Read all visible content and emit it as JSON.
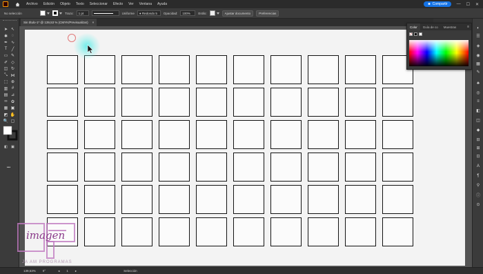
{
  "menubar": {
    "items": [
      "Archivo",
      "Edición",
      "Objeto",
      "Texto",
      "Seleccionar",
      "Efecto",
      "Ver",
      "Ventana",
      "Ayuda"
    ],
    "share_label": "Compartir"
  },
  "controlbar": {
    "selection_label": "No selección",
    "stroke_label": "Trazo:",
    "stroke_weight": "1 pt",
    "stroke_profile": "Uniforme",
    "brush": "Redondo 5",
    "opacity_label": "Opacidad:",
    "opacity_value": "100%",
    "style_label": "Estilo:",
    "arrange_label": "Ajustar documento",
    "prefs_label": "Preferencias"
  },
  "document": {
    "tab_title": "Sin título-1* @ 139,53 % (CMYK/Previsualizar)",
    "close_glyph": "×"
  },
  "grid": {
    "columns": 10,
    "rows": 6
  },
  "color_panel": {
    "tabs": [
      "Color",
      "Guía de co",
      "Muestras"
    ],
    "active_tab": "Color",
    "menu_glyph": "≡"
  },
  "statusbar": {
    "zoom": "139,53%",
    "rotation": "0°",
    "artboard": "1",
    "tool_label": "Selección"
  },
  "watermark": {
    "logo_text": "imagen",
    "sub_text": "JA AM PROGRAMAS"
  },
  "colors": {
    "accent": "#1473e6",
    "app_logo": "#ff9a00",
    "watermark": "#8a3b8a",
    "cursor_glow": "#40ebe6",
    "cursor_ring": "#e07878"
  }
}
